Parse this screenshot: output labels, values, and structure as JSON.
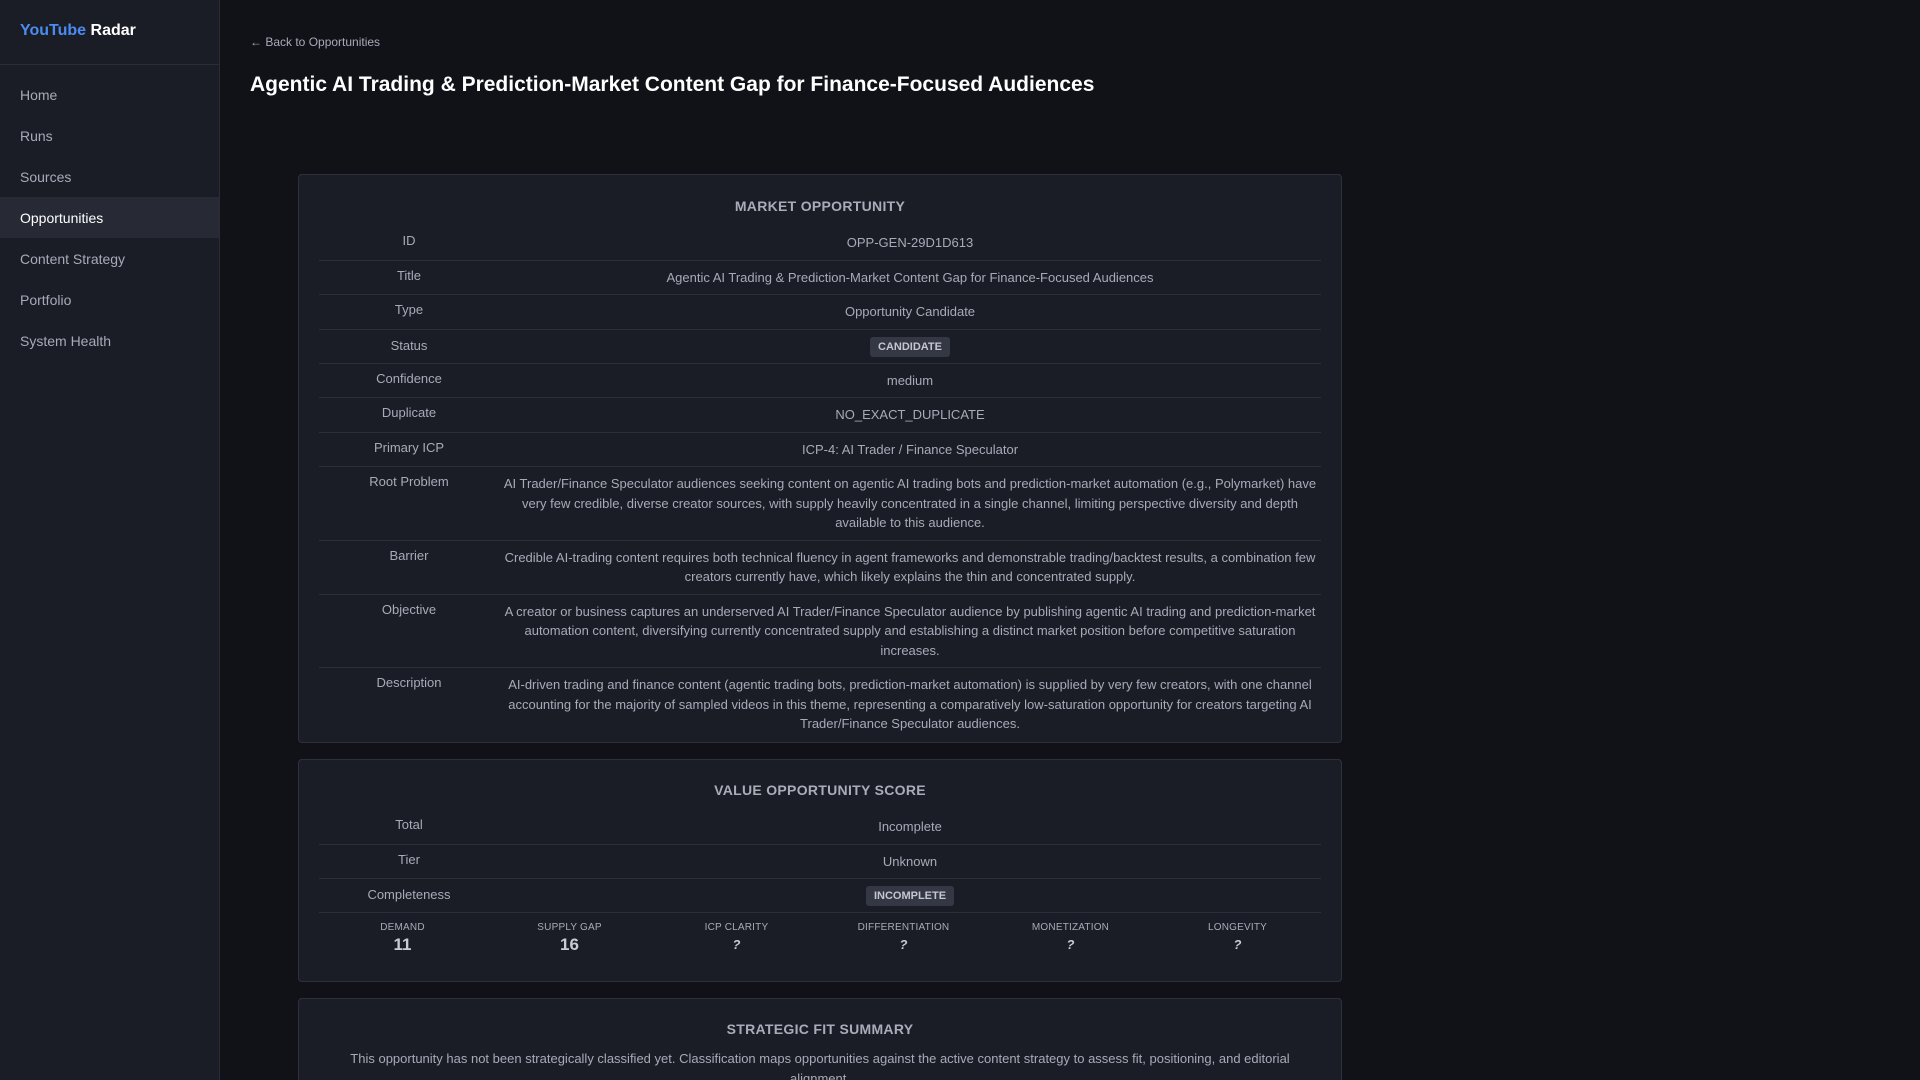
{
  "brand": {
    "part1": "YouTube",
    "part2": "Radar"
  },
  "nav": [
    {
      "label": "Home"
    },
    {
      "label": "Runs"
    },
    {
      "label": "Sources"
    },
    {
      "label": "Opportunities",
      "active": true
    },
    {
      "label": "Content Strategy"
    },
    {
      "label": "Portfolio"
    },
    {
      "label": "System Health"
    }
  ],
  "back_link": "← Back to Opportunities",
  "page_title": "Agentic AI Trading & Prediction-Market Content Gap for Finance-Focused Audiences",
  "market": {
    "title": "MARKET OPPORTUNITY",
    "rows": [
      {
        "key": "ID",
        "value": "OPP-GEN-29D1D613"
      },
      {
        "key": "Title",
        "value": "Agentic AI Trading & Prediction-Market Content Gap for Finance-Focused Audiences"
      },
      {
        "key": "Type",
        "value": "Opportunity Candidate"
      },
      {
        "key": "Status",
        "value": "CANDIDATE"
      },
      {
        "key": "Confidence",
        "value": "medium"
      },
      {
        "key": "Duplicate",
        "value": "NO_EXACT_DUPLICATE"
      },
      {
        "key": "Primary ICP",
        "value": "ICP-4: AI Trader / Finance Speculator"
      },
      {
        "key": "Root Problem",
        "value": "AI Trader/Finance Speculator audiences seeking content on agentic AI trading bots and prediction-market automation (e.g., Polymarket) have very few credible, diverse creator sources, with supply heavily concentrated in a single channel, limiting perspective diversity and depth available to this audience."
      },
      {
        "key": "Barrier",
        "value": "Credible AI-trading content requires both technical fluency in agent frameworks and demonstrable trading/backtest results, a combination few creators currently have, which likely explains the thin and concentrated supply."
      },
      {
        "key": "Objective",
        "value": "A creator or business captures an underserved AI Trader/Finance Speculator audience by publishing agentic AI trading and prediction-market automation content, diversifying currently concentrated supply and establishing a distinct market position before competitive saturation increases."
      },
      {
        "key": "Description",
        "value": "AI-driven trading and finance content (agentic trading bots, prediction-market automation) is supplied by very few creators, with one channel accounting for the majority of sampled videos in this theme, representing a comparatively low-saturation opportunity for creators targeting AI Trader/Finance Speculator audiences."
      }
    ]
  },
  "vos": {
    "title": "VALUE OPPORTUNITY SCORE",
    "rows": [
      {
        "key": "Total",
        "value": "Incomplete"
      },
      {
        "key": "Tier",
        "value": "Unknown"
      },
      {
        "key": "Completeness",
        "value": "INCOMPLETE"
      }
    ],
    "scores": [
      {
        "label": "DEMAND",
        "value": "11"
      },
      {
        "label": "SUPPLY GAP",
        "value": "16"
      },
      {
        "label": "ICP CLARITY",
        "value": "?"
      },
      {
        "label": "DIFFERENTIATION",
        "value": "?"
      },
      {
        "label": "MONETIZATION",
        "value": "?"
      },
      {
        "label": "LONGEVITY",
        "value": "?"
      }
    ]
  },
  "strategic": {
    "title": "STRATEGIC FIT SUMMARY",
    "text": "This opportunity has not been strategically classified yet. Classification maps opportunities against the active content strategy to assess fit, positioning, and editorial alignment."
  }
}
